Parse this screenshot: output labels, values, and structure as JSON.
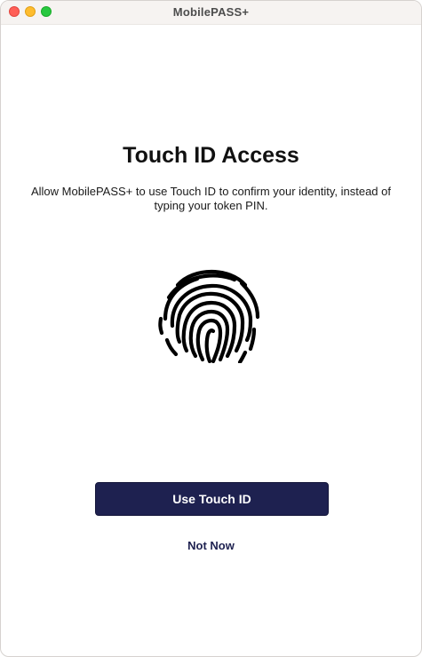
{
  "window": {
    "title": "MobilePASS+"
  },
  "main": {
    "heading": "Touch ID Access",
    "description": "Allow MobilePASS+ to use Touch ID to confirm your identity, instead of typing your token PIN.",
    "icon": "fingerprint-icon",
    "primary_button_label": "Use Touch ID",
    "secondary_link_label": "Not Now"
  },
  "colors": {
    "primary_button": "#1e2150",
    "link": "#1e2150",
    "traffic_close": "#ff5f57",
    "traffic_minimize": "#febc2e",
    "traffic_maximize": "#28c840"
  }
}
